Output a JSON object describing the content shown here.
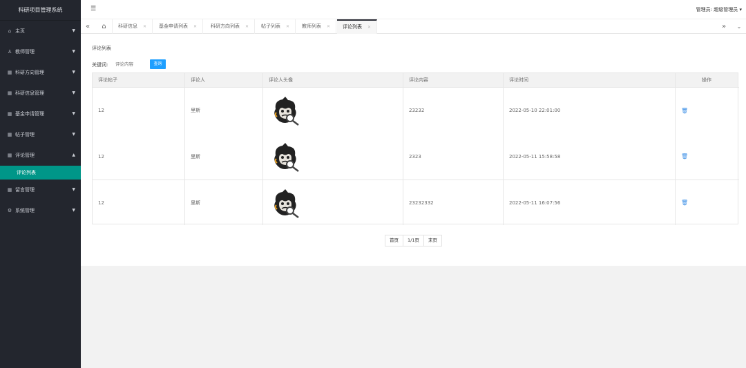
{
  "app": {
    "title": "科研项目管理系统"
  },
  "sidebar": {
    "items": [
      {
        "label": "主页",
        "icon": "home-icon",
        "glyph": "⌂"
      },
      {
        "label": "教师管理",
        "icon": "user-icon",
        "glyph": "♙"
      },
      {
        "label": "科研方向管理",
        "icon": "calendar-icon",
        "glyph": "▦"
      },
      {
        "label": "科研信息管理",
        "icon": "calendar-icon",
        "glyph": "▦"
      },
      {
        "label": "基金申请管理",
        "icon": "calendar-icon",
        "glyph": "▦"
      },
      {
        "label": "帖子管理",
        "icon": "calendar-icon",
        "glyph": "▦"
      },
      {
        "label": "评论管理",
        "icon": "calendar-icon",
        "glyph": "▦"
      },
      {
        "label": "留言管理",
        "icon": "calendar-icon",
        "glyph": "▦"
      },
      {
        "label": "系统管理",
        "icon": "gear-icon",
        "glyph": "⚙"
      }
    ],
    "active_sub": "评论列表"
  },
  "header": {
    "admin_label": "管理员: 超级管理员 ▾"
  },
  "tabs": [
    {
      "label": "科研信息"
    },
    {
      "label": "基金申请列表"
    },
    {
      "label": "科研方向列表"
    },
    {
      "label": "帖子列表"
    },
    {
      "label": "教师列表"
    },
    {
      "label": "评论列表"
    }
  ],
  "page": {
    "title": "评论列表",
    "keyword_label": "关键词:",
    "keyword_placeholder": "评论内容",
    "query_button": "查询"
  },
  "table": {
    "headers": [
      "评论帖子",
      "评论人",
      "评论人头像",
      "评论内容",
      "评论时间",
      "操作"
    ],
    "rows": [
      {
        "post": "12",
        "user": "里斯",
        "content": "23232",
        "time": "2022-05-10 22:01:00"
      },
      {
        "post": "12",
        "user": "里斯",
        "content": "2323",
        "time": "2022-05-11 15:58:58"
      },
      {
        "post": "12",
        "user": "里斯",
        "content": "23232332",
        "time": "2022-05-11 16:07:56"
      }
    ]
  },
  "pager": {
    "first": "首页",
    "info": "1/1页",
    "last": "末页"
  },
  "colors": {
    "sidebar": "#23262e",
    "accent": "#009688",
    "button": "#1e9fff"
  }
}
